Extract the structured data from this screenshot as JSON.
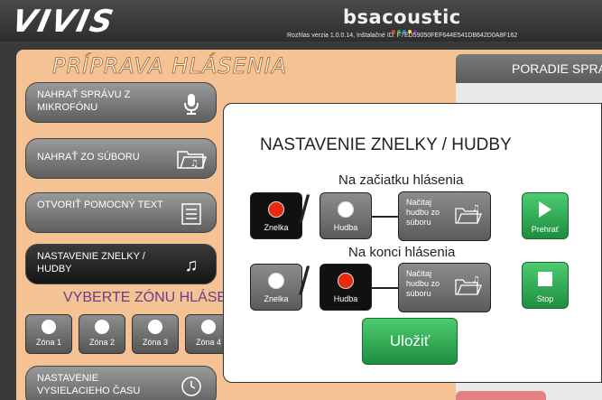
{
  "header": {
    "logo": "VIVIS",
    "brand": "bsacoustic",
    "version_text": "Rozhlas verzia 1.0.0.14, Inštalačné ID: F7ED59050FEF644E541DB642D0A8F162",
    "dot_colors": [
      "#e53935",
      "#43a047",
      "#1e88e5",
      "#fdd835",
      "#8e24aa"
    ]
  },
  "panel": {
    "title": "PRÍPRAVA HLÁSENIA",
    "menu": [
      {
        "label": "NAHRAŤ SPRÁVU Z MIKROFÓNU",
        "icon": "microphone-icon"
      },
      {
        "label": "NAHRAŤ ZO SÚBORU",
        "icon": "folder-music-icon"
      },
      {
        "label": "OTVORIŤ POMOCNÝ TEXT",
        "icon": "document-icon"
      },
      {
        "label": "NASTAVENIE ZNELKY / HUDBY",
        "icon": "music-note-icon"
      },
      {
        "label": "NASTAVENIE VYSIELACIEHO ČASU",
        "icon": "clock-icon"
      }
    ],
    "zone_title": "VYBERTE ZÓNU HLÁSENIA",
    "zones": [
      "Zóna 1",
      "Zóna 2",
      "Zóna 3",
      "Zóna 4"
    ]
  },
  "right_panel": {
    "title": "PORADIE SPRÁV"
  },
  "modal": {
    "title": "NASTAVENIE ZNELKY / HUDBY",
    "start_section": {
      "label": "Na začiatku hlásenia",
      "jingle_label": "Znelka",
      "music_label": "Hudba",
      "selected": "Znelka",
      "load_label": "Načítaj hudbu zo súboru",
      "action_label": "Prehrať"
    },
    "end_section": {
      "label": "Na konci hlásenia",
      "jingle_label": "Znelka",
      "music_label": "Hudba",
      "selected": "Hudba",
      "load_label": "Načítaj hudbu zo súboru",
      "action_label": "Stop"
    },
    "save_label": "Uložiť"
  }
}
